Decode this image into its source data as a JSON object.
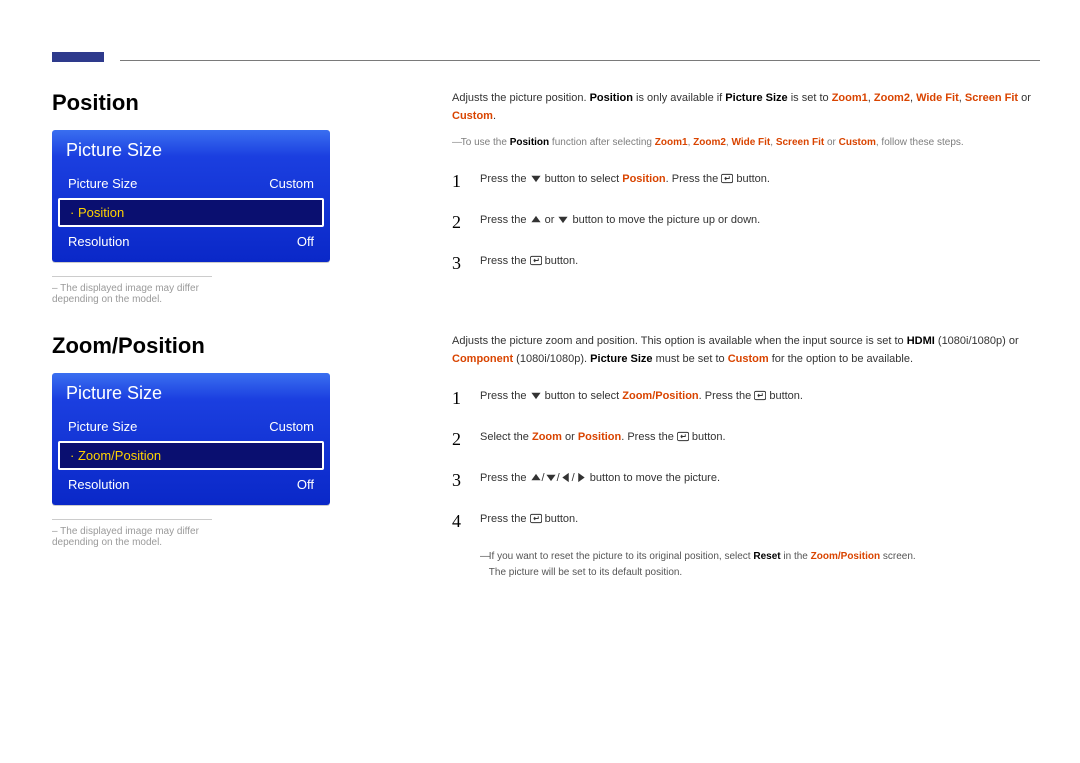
{
  "section1": {
    "heading": "Position",
    "menu": {
      "title": "Picture Size",
      "rows": [
        {
          "label": "Picture Size",
          "value": "Custom",
          "sel": false,
          "bullet": false
        },
        {
          "label": "Position",
          "value": "",
          "sel": true,
          "bullet": true
        },
        {
          "label": "Resolution",
          "value": "Off",
          "sel": false,
          "bullet": false
        }
      ]
    },
    "caption": "The displayed image may differ depending on the model.",
    "desc": {
      "d1_a": "Adjusts the picture position. ",
      "d1_b": "Position",
      "d1_c": " is only available if ",
      "d1_d": "Picture Size",
      "d1_e": " is set to ",
      "d1_f_items": [
        "Zoom1",
        "Zoom2",
        "Wide Fit",
        "Screen Fit",
        "Custom"
      ],
      "d1_g": "."
    },
    "note": {
      "a": "To use the ",
      "b": "Position",
      "c": " function after selecting ",
      "items": [
        "Zoom1",
        "Zoom2",
        "Wide Fit",
        "Screen Fit"
      ],
      "d": " or ",
      "e": "Custom",
      "f": ", follow these steps."
    },
    "steps": [
      {
        "a": "Press the ",
        "icon": "down",
        "b": " button to select ",
        "c": "Position",
        "d": ". Press the ",
        "icon2": "enter",
        "e": " button."
      },
      {
        "a": "Press the ",
        "icon": "up",
        "b": " or ",
        "icon2": "down",
        "c": " button to move the picture up or down."
      },
      {
        "a": "Press the ",
        "icon": "enter",
        "b": " button."
      }
    ]
  },
  "section2": {
    "heading": "Zoom/Position",
    "menu": {
      "title": "Picture Size",
      "rows": [
        {
          "label": "Picture Size",
          "value": "Custom",
          "sel": false,
          "bullet": false
        },
        {
          "label": "Zoom/Position",
          "value": "",
          "sel": true,
          "bullet": true
        },
        {
          "label": "Resolution",
          "value": "Off",
          "sel": false,
          "bullet": false
        }
      ]
    },
    "caption": "The displayed image may differ depending on the model.",
    "desc": {
      "a": "Adjusts the picture zoom and position. This option is available when the input source is set to ",
      "b": "HDMI",
      "c": " (1080i/1080p) or ",
      "d": "Component",
      "e": " (1080i/1080p). ",
      "f": "Picture Size",
      "g": " must be set to ",
      "h": "Custom",
      "i": " for the option to be available."
    },
    "steps": [
      {
        "a": "Press the ",
        "icon": "down",
        "b": " button to select ",
        "c": "Zoom/Position",
        "d": ". Press the ",
        "icon2": "enter",
        "e": " button."
      },
      {
        "a": "Select the ",
        "b": "Zoom",
        "c": " or ",
        "d": "Position",
        "e": ". Press the ",
        "icon": "enter",
        "f": " button."
      },
      {
        "a": "Press the ",
        "icon": "up",
        "slash1": "/",
        "icon2": "down",
        "slash2": "/",
        "icon3": "left",
        "slash3": "/",
        "icon4": "right",
        "b": " button to move the picture."
      },
      {
        "a": "Press the ",
        "icon": "enter",
        "b": " button."
      }
    ],
    "footnote": {
      "a": "If you want to reset the picture to its original position, select ",
      "b": "Reset",
      "c": " in the ",
      "d": "Zoom/Position",
      "e": " screen.",
      "f": "The picture will be set to its default position."
    }
  }
}
